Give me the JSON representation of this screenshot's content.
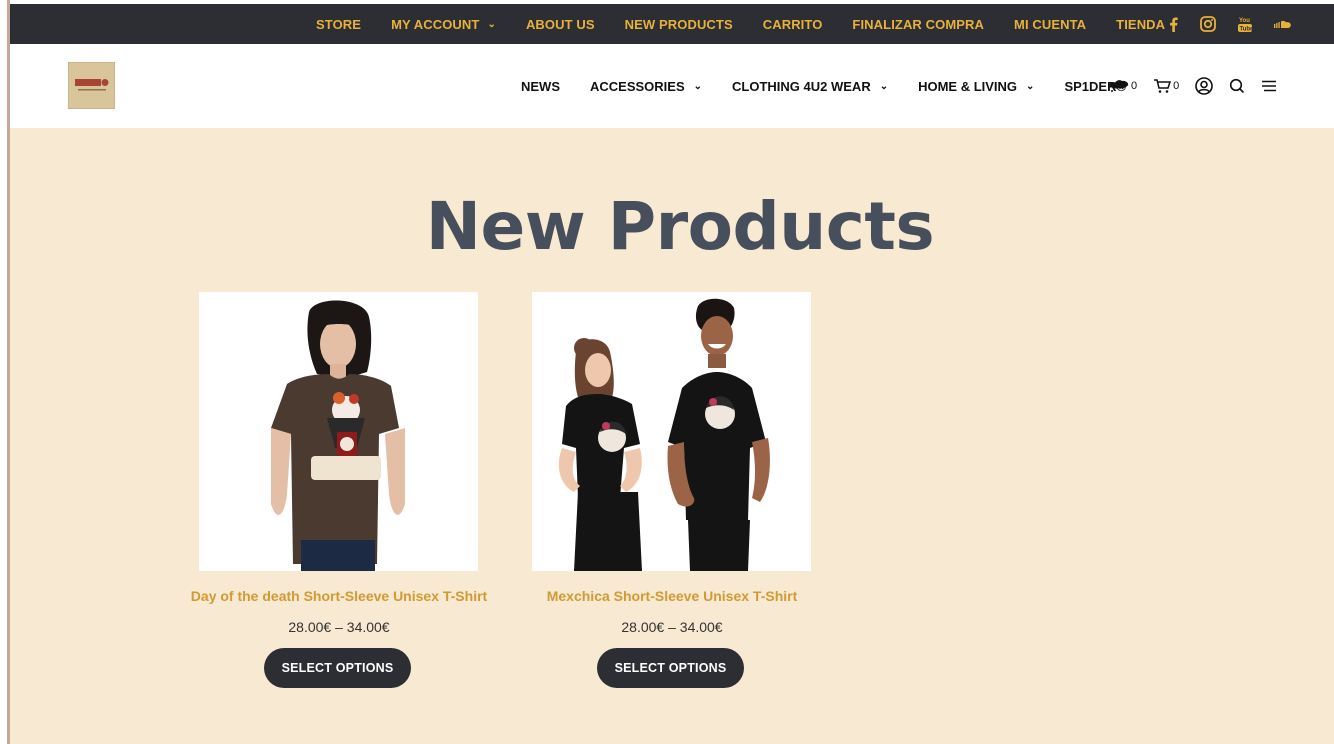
{
  "topbar": {
    "links": [
      {
        "label": "STORE",
        "dropdown": false
      },
      {
        "label": "MY ACCOUNT",
        "dropdown": true
      },
      {
        "label": "ABOUT US",
        "dropdown": false
      },
      {
        "label": "NEW PRODUCTS",
        "dropdown": false
      },
      {
        "label": "CARRITO",
        "dropdown": false
      },
      {
        "label": "FINALIZAR COMPRA",
        "dropdown": false
      },
      {
        "label": "MI CUENTA",
        "dropdown": false
      },
      {
        "label": "TIENDA",
        "dropdown": false
      }
    ],
    "social_icons": [
      "facebook-icon",
      "instagram-icon",
      "youtube-icon",
      "soundcloud-icon"
    ],
    "accent_color": "#e8b13a",
    "background": "#2c2e33"
  },
  "header": {
    "logo_icon": "brand-logo",
    "nav": [
      {
        "label": "NEWS",
        "dropdown": false
      },
      {
        "label": "ACCESSORIES",
        "dropdown": true
      },
      {
        "label": "CLOTHING 4U2 WEAR",
        "dropdown": true
      },
      {
        "label": "HOME & LIVING",
        "dropdown": true
      },
      {
        "label": "SP1DER®",
        "dropdown": false
      }
    ],
    "wishlist_count": "0",
    "cart_count": "0",
    "icons": [
      "wishlist-icon",
      "cart-icon",
      "account-icon",
      "search-icon",
      "menu-icon"
    ]
  },
  "main": {
    "title": "New Products",
    "background": "#f8e9d2",
    "products": [
      {
        "name": "Day of the death Short-Sleeve Unisex T-Shirt",
        "price": "28.00€ – 34.00€",
        "button": "SELECT OPTIONS"
      },
      {
        "name": "Mexchica Short-Sleeve Unisex T-Shirt",
        "price": "28.00€ – 34.00€",
        "button": "SELECT OPTIONS"
      }
    ]
  }
}
